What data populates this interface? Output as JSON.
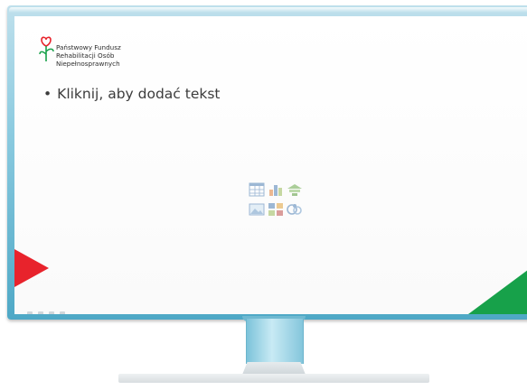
{
  "slide": {
    "org_name": [
      "Państwowy Fundusz",
      "Rehabilitacji Osób",
      "Niepełnosprawnych"
    ],
    "bullet": "•",
    "placeholder_text": "Kliknij, aby dodać tekst",
    "content_placeholder_icons": [
      "table-icon",
      "chart-icon",
      "smartart-icon",
      "picture-icon",
      "clip-art-icon",
      "media-icon"
    ]
  },
  "colors": {
    "accent_red": "#e8232c",
    "accent_green": "#17a14a",
    "monitor_blue": "#4ea8c6"
  }
}
